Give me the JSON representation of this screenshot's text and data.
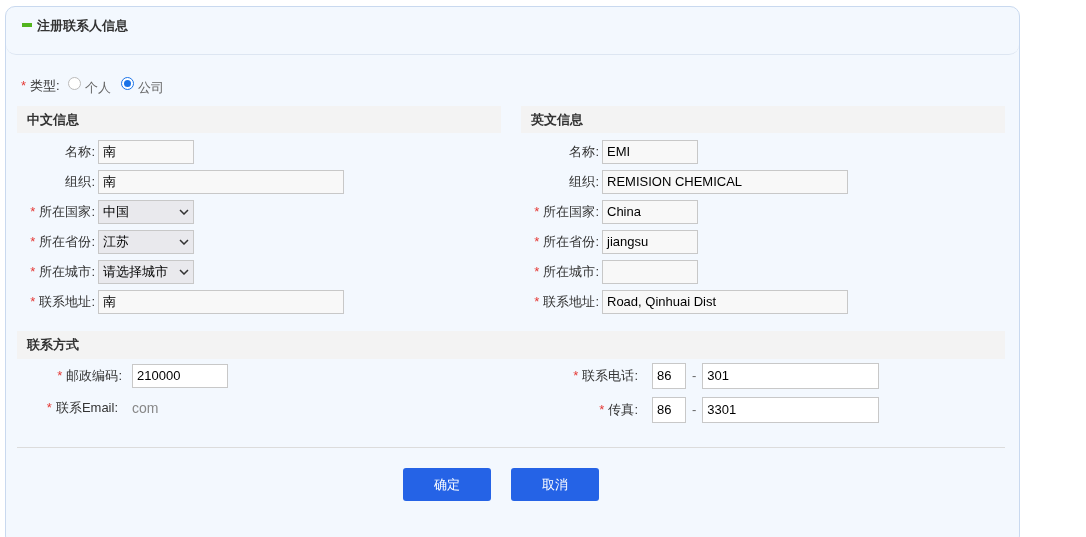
{
  "panel": {
    "title": "注册联系人信息"
  },
  "type_field": {
    "mark": "*",
    "label": "类型:",
    "options": [
      {
        "label": "个人",
        "selected": false
      },
      {
        "label": "公司",
        "selected": true
      }
    ]
  },
  "chinese_info": {
    "heading": "中文信息",
    "fields": [
      {
        "kind": "short",
        "label": "名称:",
        "value": "南"
      },
      {
        "kind": "long",
        "label": "组织:",
        "value": "南"
      },
      {
        "kind": "select",
        "mark": "*",
        "label": "所在国家:",
        "value": "中国"
      },
      {
        "kind": "select",
        "mark": "*",
        "label": "所在省份:",
        "value": "江苏"
      },
      {
        "kind": "select",
        "mark": "*",
        "label": "所在城市:",
        "value": "请选择城市"
      },
      {
        "kind": "long",
        "mark": "*",
        "label": "联系地址:",
        "value": "南"
      }
    ]
  },
  "english_info": {
    "heading": "英文信息",
    "fields": [
      {
        "kind": "short",
        "label": "名称:",
        "value": "EMI"
      },
      {
        "kind": "long",
        "label": "组织:",
        "value": "REMISION CHEMICAL"
      },
      {
        "kind": "short",
        "mark": "*",
        "label": "所在国家:",
        "value": "China"
      },
      {
        "kind": "short",
        "mark": "*",
        "label": "所在省份:",
        "value": "jiangsu"
      },
      {
        "kind": "short",
        "mark": "*",
        "label": "所在城市:"
      },
      {
        "kind": "long",
        "mark": "*",
        "label": "联系地址:",
        "value": "Road, Qinhuai Dist"
      }
    ]
  },
  "contact": {
    "heading": "联系方式",
    "postcode": {
      "mark": "*",
      "label": "邮政编码:",
      "value": "210000"
    },
    "email": {
      "mark": "*",
      "label": "联系Email:",
      "value": "com"
    },
    "phone": {
      "mark": "*",
      "label": "联系电话:",
      "country_code": "86",
      "separator": "-",
      "number": "301"
    },
    "fax": {
      "mark": "*",
      "label": "传真:",
      "country_code": "86",
      "separator": "-",
      "number": "3301"
    }
  },
  "buttons": [
    {
      "label": "确定"
    },
    {
      "label": "取消"
    }
  ]
}
